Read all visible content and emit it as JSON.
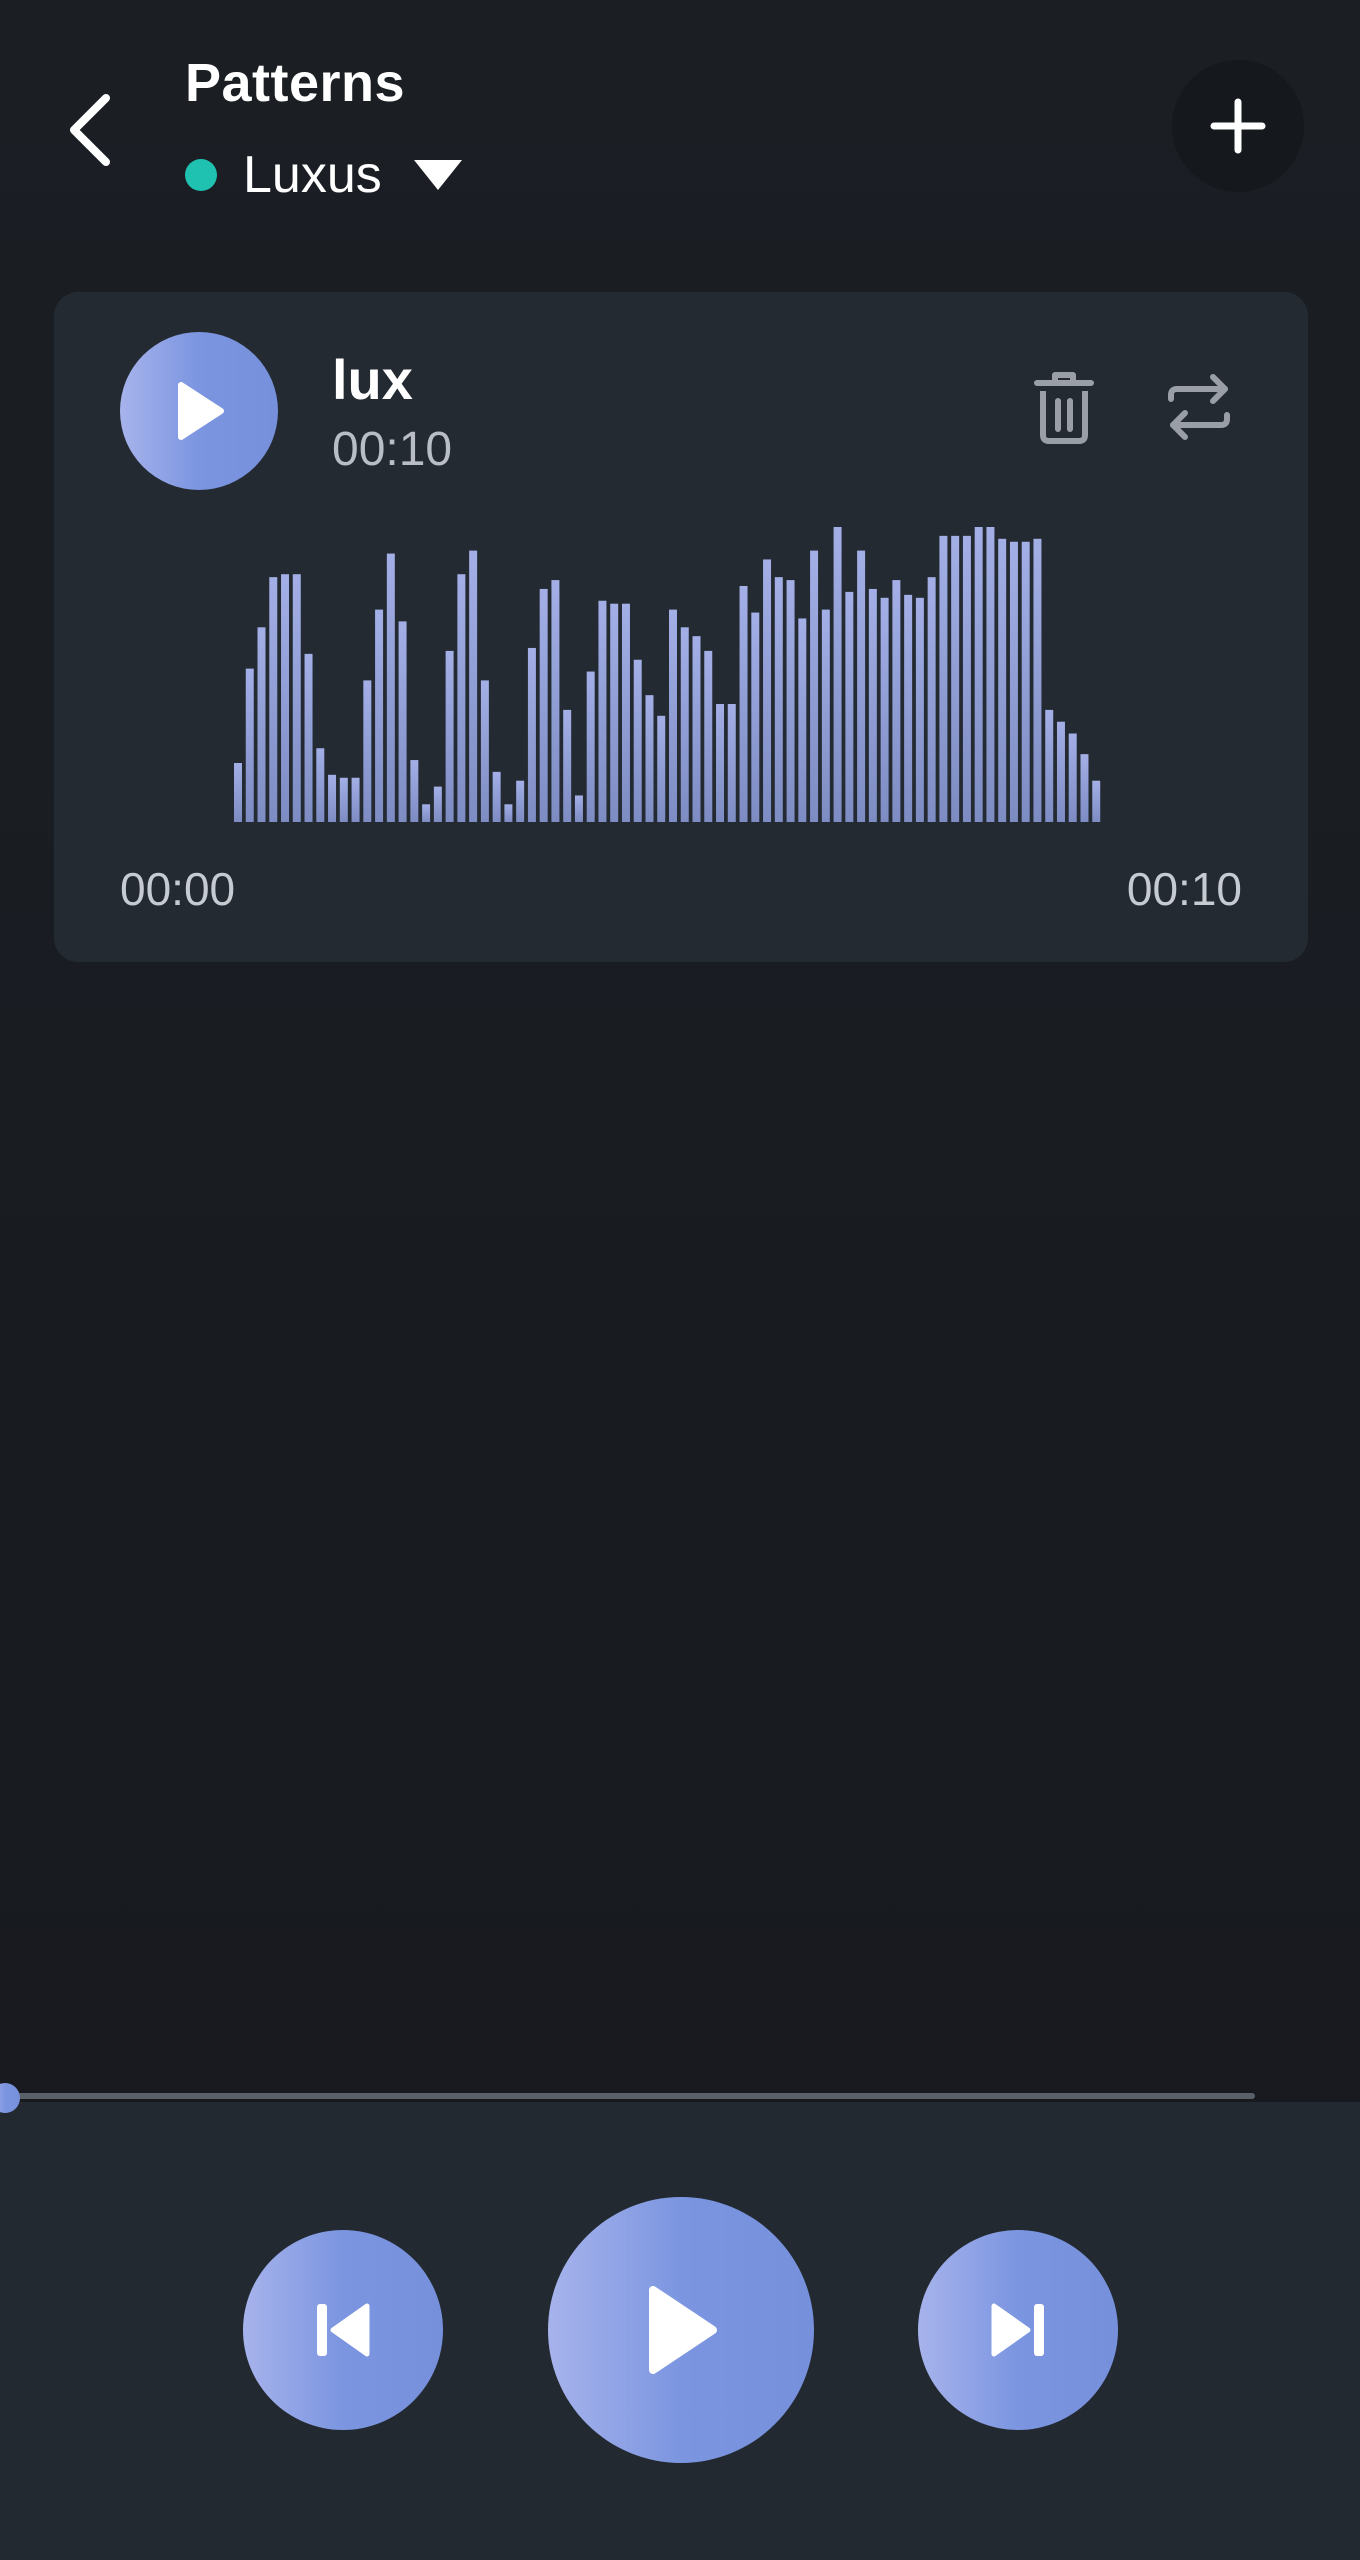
{
  "header": {
    "title": "Patterns",
    "device_name": "Luxus",
    "device_status_color": "#1fc2b0"
  },
  "pattern_card": {
    "name": "lux",
    "duration": "00:10",
    "time_start": "00:00",
    "time_end": "00:10",
    "waveform_levels": [
      0.2,
      0.52,
      0.66,
      0.83,
      0.84,
      0.84,
      0.57,
      0.25,
      0.16,
      0.15,
      0.15,
      0.48,
      0.72,
      0.91,
      0.68,
      0.21,
      0.06,
      0.12,
      0.58,
      0.84,
      0.92,
      0.48,
      0.17,
      0.06,
      0.14,
      0.59,
      0.79,
      0.82,
      0.38,
      0.09,
      0.51,
      0.75,
      0.74,
      0.74,
      0.55,
      0.43,
      0.36,
      0.72,
      0.66,
      0.63,
      0.58,
      0.4,
      0.4,
      0.8,
      0.71,
      0.89,
      0.83,
      0.82,
      0.69,
      0.92,
      0.72,
      1.0,
      0.78,
      0.92,
      0.79,
      0.76,
      0.82,
      0.77,
      0.76,
      0.83,
      0.97,
      0.97,
      0.97,
      1.0,
      1.0,
      0.96,
      0.95,
      0.95,
      0.96,
      0.38,
      0.34,
      0.3,
      0.23,
      0.14
    ],
    "icons": {
      "play": "play-icon",
      "delete": "trash-icon",
      "repeat": "repeat-icon"
    }
  },
  "player": {
    "progress": 0.0,
    "icons": {
      "previous": "skip-previous-icon",
      "play": "play-icon",
      "next": "skip-next-icon"
    }
  },
  "colors": {
    "background": "#181b20",
    "card": "#232a32",
    "accent_start": "#a7b3ec",
    "accent_end": "#7690dc",
    "waveform": "#9aa6dd"
  }
}
